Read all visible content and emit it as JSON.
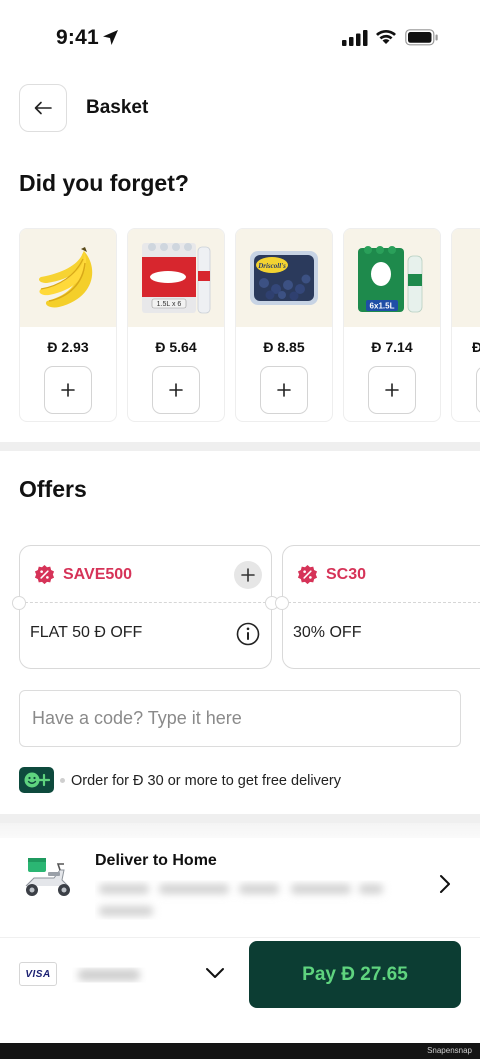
{
  "status_bar": {
    "time": "9:41"
  },
  "header": {
    "title": "Basket"
  },
  "forget_section": {
    "title": "Did you forget?",
    "products": [
      {
        "name": "bananas",
        "price": "Đ 2.93"
      },
      {
        "name": "water-pack-6x1.5l",
        "price": "Đ 5.64",
        "pack_label": "1.5L x 6"
      },
      {
        "name": "blueberries",
        "price": "Đ 8.85",
        "brand_label": "Driscoll's"
      },
      {
        "name": "al-ain-water-6x1.5l",
        "price": "Đ 7.14",
        "pack_label": "6x1.5L"
      }
    ]
  },
  "offers": {
    "title": "Offers",
    "items": [
      {
        "code": "SAVE500",
        "description": "FLAT 50 Đ OFF"
      },
      {
        "code": "SC30",
        "description": "30% OFF"
      }
    ],
    "code_input_placeholder": "Have a code? Type it here",
    "promo_badge": "☺+",
    "promo_text": "Order for Đ 30 or more to get free delivery"
  },
  "delivery": {
    "title": "Deliver to Home"
  },
  "payment": {
    "card_brand": "VISA",
    "pay_label": "Pay Đ 27.65"
  },
  "watermark": "Snapensnap",
  "colors": {
    "accent_dark_green": "#0c3d33",
    "accent_light_green": "#5fd47f",
    "offer_pink": "#d63358",
    "product_bg": "#f7f3e8"
  }
}
